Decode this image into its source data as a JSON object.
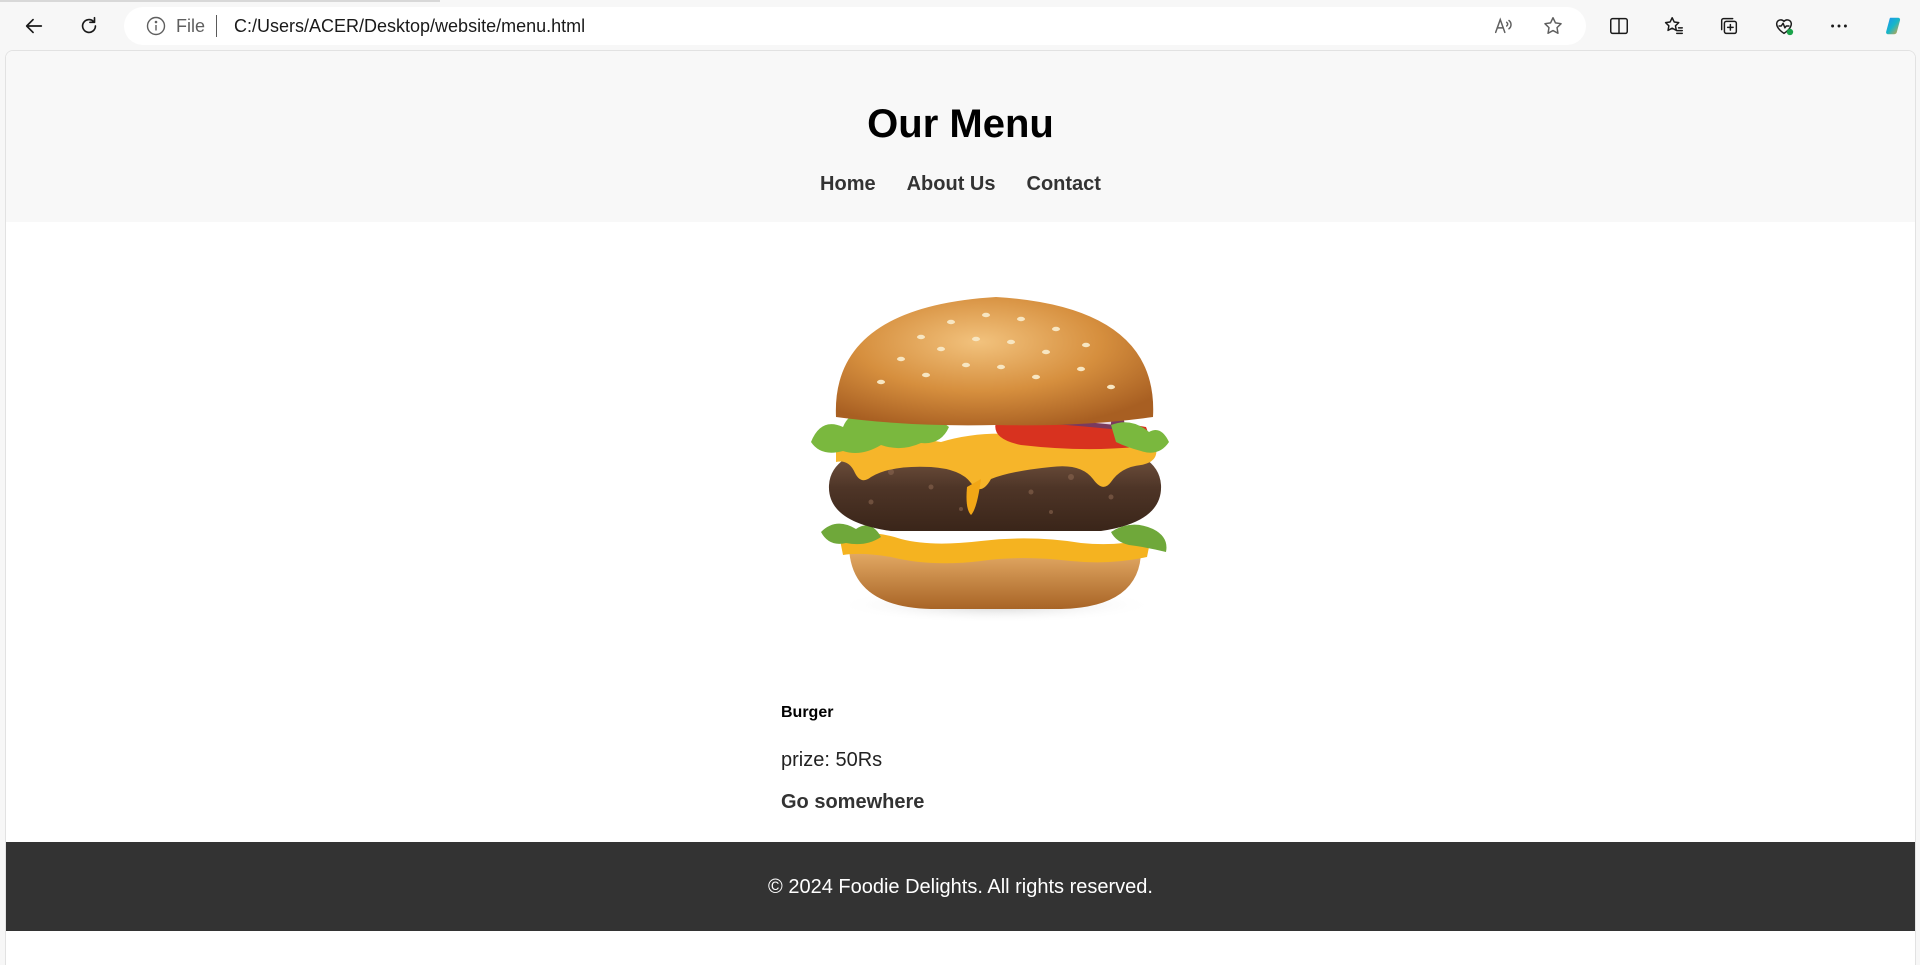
{
  "browser": {
    "address_file_label": "File",
    "url": "C:/Users/ACER/Desktop/website/menu.html",
    "icons": [
      "back-icon",
      "refresh-icon",
      "info-icon",
      "read-aloud-icon",
      "favorite-star-icon",
      "split-screen-icon",
      "favorites-icon",
      "collections-icon",
      "browser-essentials-icon",
      "more-icon",
      "copilot-icon"
    ]
  },
  "header": {
    "title": "Our Menu",
    "nav": [
      "Home",
      "About Us",
      "Contact"
    ]
  },
  "menu_item": {
    "name": "Burger",
    "price": "prize: 50Rs",
    "link": "Go somewhere",
    "image": "burger-image"
  },
  "footer": {
    "text": "© 2024 Foodie Delights. All rights reserved."
  },
  "colors": {
    "header_bg": "#f8f8f8",
    "footer_bg": "#333333",
    "footer_text": "#ffffff",
    "nav_text": "#333333"
  }
}
